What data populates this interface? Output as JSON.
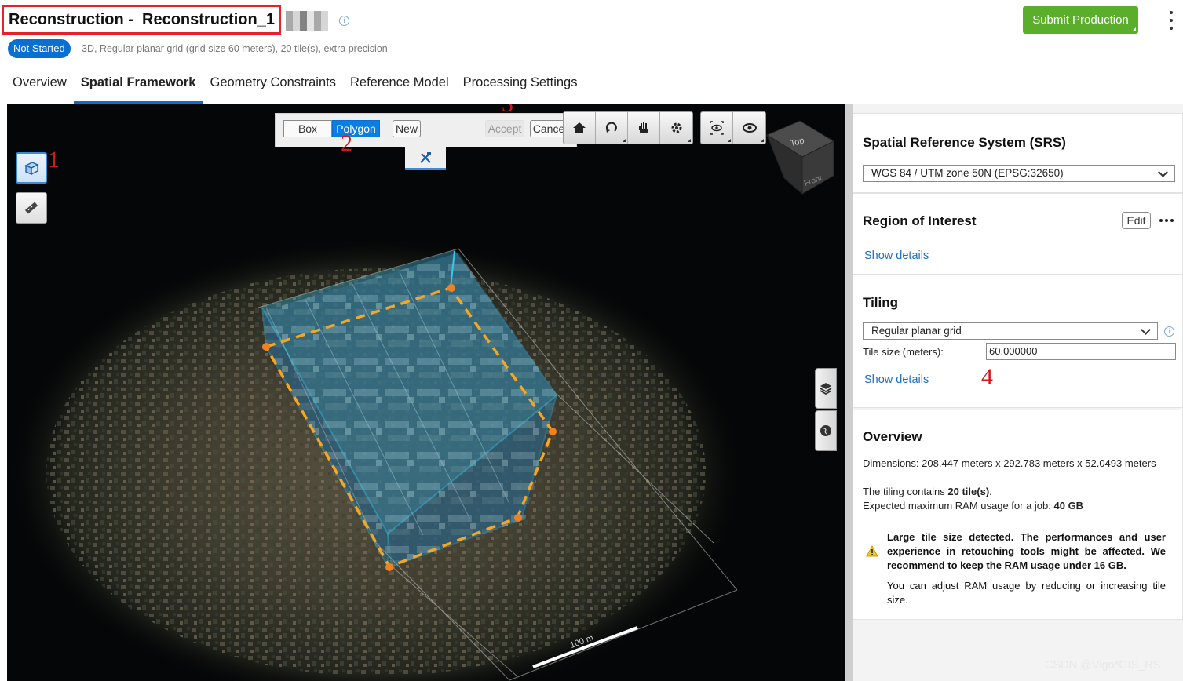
{
  "header": {
    "title": "Reconstruction -  Reconstruction_1",
    "status": "Not Started",
    "subtitle": "3D, Regular planar grid (grid size 60 meters), 20 tile(s), extra precision",
    "submit_label": "Submit Production"
  },
  "tabs": [
    {
      "label": "Overview",
      "active": false
    },
    {
      "label": "Spatial Framework",
      "active": true
    },
    {
      "label": "Geometry Constraints",
      "active": false
    },
    {
      "label": "Reference Model",
      "active": false
    },
    {
      "label": "Processing Settings",
      "active": false
    }
  ],
  "viewport": {
    "polygon_toolbar": {
      "box_label": "Box",
      "polygon_label": "Polygon",
      "new_label": "New",
      "accept_label": "Accept",
      "cancel_label": "Cance"
    },
    "view_cube": {
      "top_label": "Top",
      "front_label": "Front"
    },
    "scale_label": "100 m",
    "annotations": [
      "1",
      "2",
      "3",
      "4"
    ]
  },
  "panel": {
    "srs": {
      "title": "Spatial Reference System (SRS)",
      "value": "WGS 84 / UTM zone 50N (EPSG:32650)"
    },
    "roi": {
      "title": "Region of Interest",
      "edit_label": "Edit",
      "show_details": "Show details"
    },
    "tiling": {
      "title": "Tiling",
      "mode": "Regular planar grid",
      "tile_size_label": "Tile size (meters):",
      "tile_size_value": "60.000000",
      "show_details": "Show details"
    },
    "overview": {
      "title": "Overview",
      "dimensions": "Dimensions: 208.447 meters x 292.783 meters x 52.0493 meters",
      "tiles_prefix": "The tiling contains ",
      "tiles_count": "20 tile(s)",
      "tiles_suffix": ".",
      "ram_prefix": "Expected maximum RAM usage for a job: ",
      "ram_value": "40 GB",
      "warning_bold": "Large tile size detected. The performances and user experience in retouching tools might be affected. We recommend to keep the RAM usage under 16 GB.",
      "warning_text": "You can adjust RAM usage by reducing or increasing tile size."
    }
  },
  "watermark": "CSDN @Vigo*GIS_RS",
  "colors": {
    "accent": "#0a6fd0",
    "submit": "#5aae2c",
    "annotation": "#d01a1a",
    "box": "#35c8f0",
    "roi_dash": "#f5a623"
  }
}
